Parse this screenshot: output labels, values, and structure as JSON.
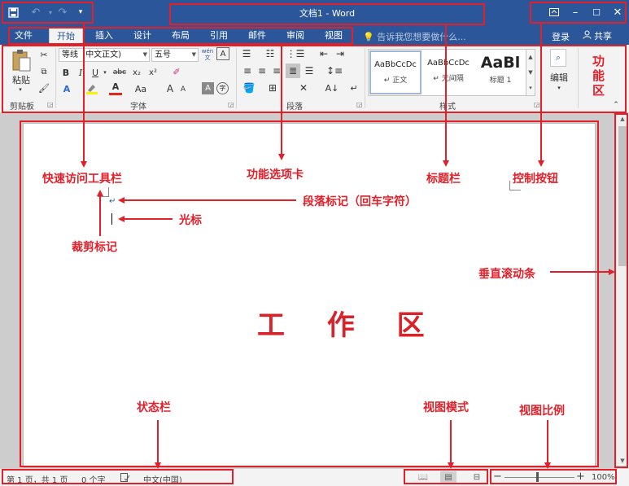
{
  "colors": {
    "accent": "#2b579a",
    "annotation": "#e2202a",
    "ribbon_bg": "#f3f3f3",
    "workspace_bg": "#cdcdcd"
  },
  "titlebar": {
    "title": "文档1 - Word",
    "qat": {
      "save_icon": "save-icon",
      "undo_icon": "undo-icon",
      "redo_icon": "redo-icon",
      "customize_icon": "customize-qat-icon"
    },
    "controls": {
      "ribbon_options_icon": "ribbon-display-options-icon",
      "minimize_icon": "minimize-icon",
      "maximize_icon": "maximize-icon",
      "close_icon": "close-icon"
    }
  },
  "tabs": [
    {
      "label": "文件"
    },
    {
      "label": "开始",
      "active": true
    },
    {
      "label": "插入"
    },
    {
      "label": "设计"
    },
    {
      "label": "布局"
    },
    {
      "label": "引用"
    },
    {
      "label": "邮件"
    },
    {
      "label": "审阅"
    },
    {
      "label": "视图"
    }
  ],
  "tell_me": "告诉我您想要做什么...",
  "login": "登录",
  "share": "共享",
  "ribbon": {
    "clipboard": {
      "label": "剪贴板",
      "paste": "粘贴"
    },
    "font": {
      "label": "字体",
      "font_name": "等线",
      "font_script": "中文正文)",
      "font_size": "五号",
      "phonetic": "wén 文",
      "bold": "B",
      "italic": "I",
      "underline": "U",
      "strikethrough": "abc",
      "subscript": "x₂",
      "superscript": "x²",
      "change_case": "Aa",
      "grow": "A",
      "shrink": "A",
      "char_shading": "A",
      "enclose": "字"
    },
    "paragraph": {
      "label": "段落"
    },
    "styles": {
      "label": "样式",
      "items": [
        {
          "sample": "AaBbCcDc",
          "name": "↵ 正文"
        },
        {
          "sample": "AaBbCcDc",
          "name": "↵ 无间隔"
        },
        {
          "sample": "AaBl",
          "name": "标题 1"
        }
      ]
    },
    "editing": {
      "label": "编辑"
    },
    "ribbon_area_label": "功能区"
  },
  "document": {
    "paragraph_mark": "↵",
    "work_area_label": "工 作 区"
  },
  "statusbar": {
    "page": "第 1 页，共 1 页",
    "words": "0 个字",
    "language": "中文(中国)",
    "zoom": "100%",
    "zoom_minus": "−",
    "zoom_plus": "+"
  },
  "annotations": {
    "quick_access": "快速访问工具栏",
    "ribbon_tabs": "功能选项卡",
    "title_bar": "标题栏",
    "control_buttons": "控制按钮",
    "paragraph_mark": "段落标记（回车字符）",
    "cursor": "光标",
    "crop_marks": "裁剪标记",
    "vertical_scroll": "垂直滚动条",
    "status_bar": "状态栏",
    "view_mode": "视图模式",
    "zoom_ratio": "视图比例"
  }
}
